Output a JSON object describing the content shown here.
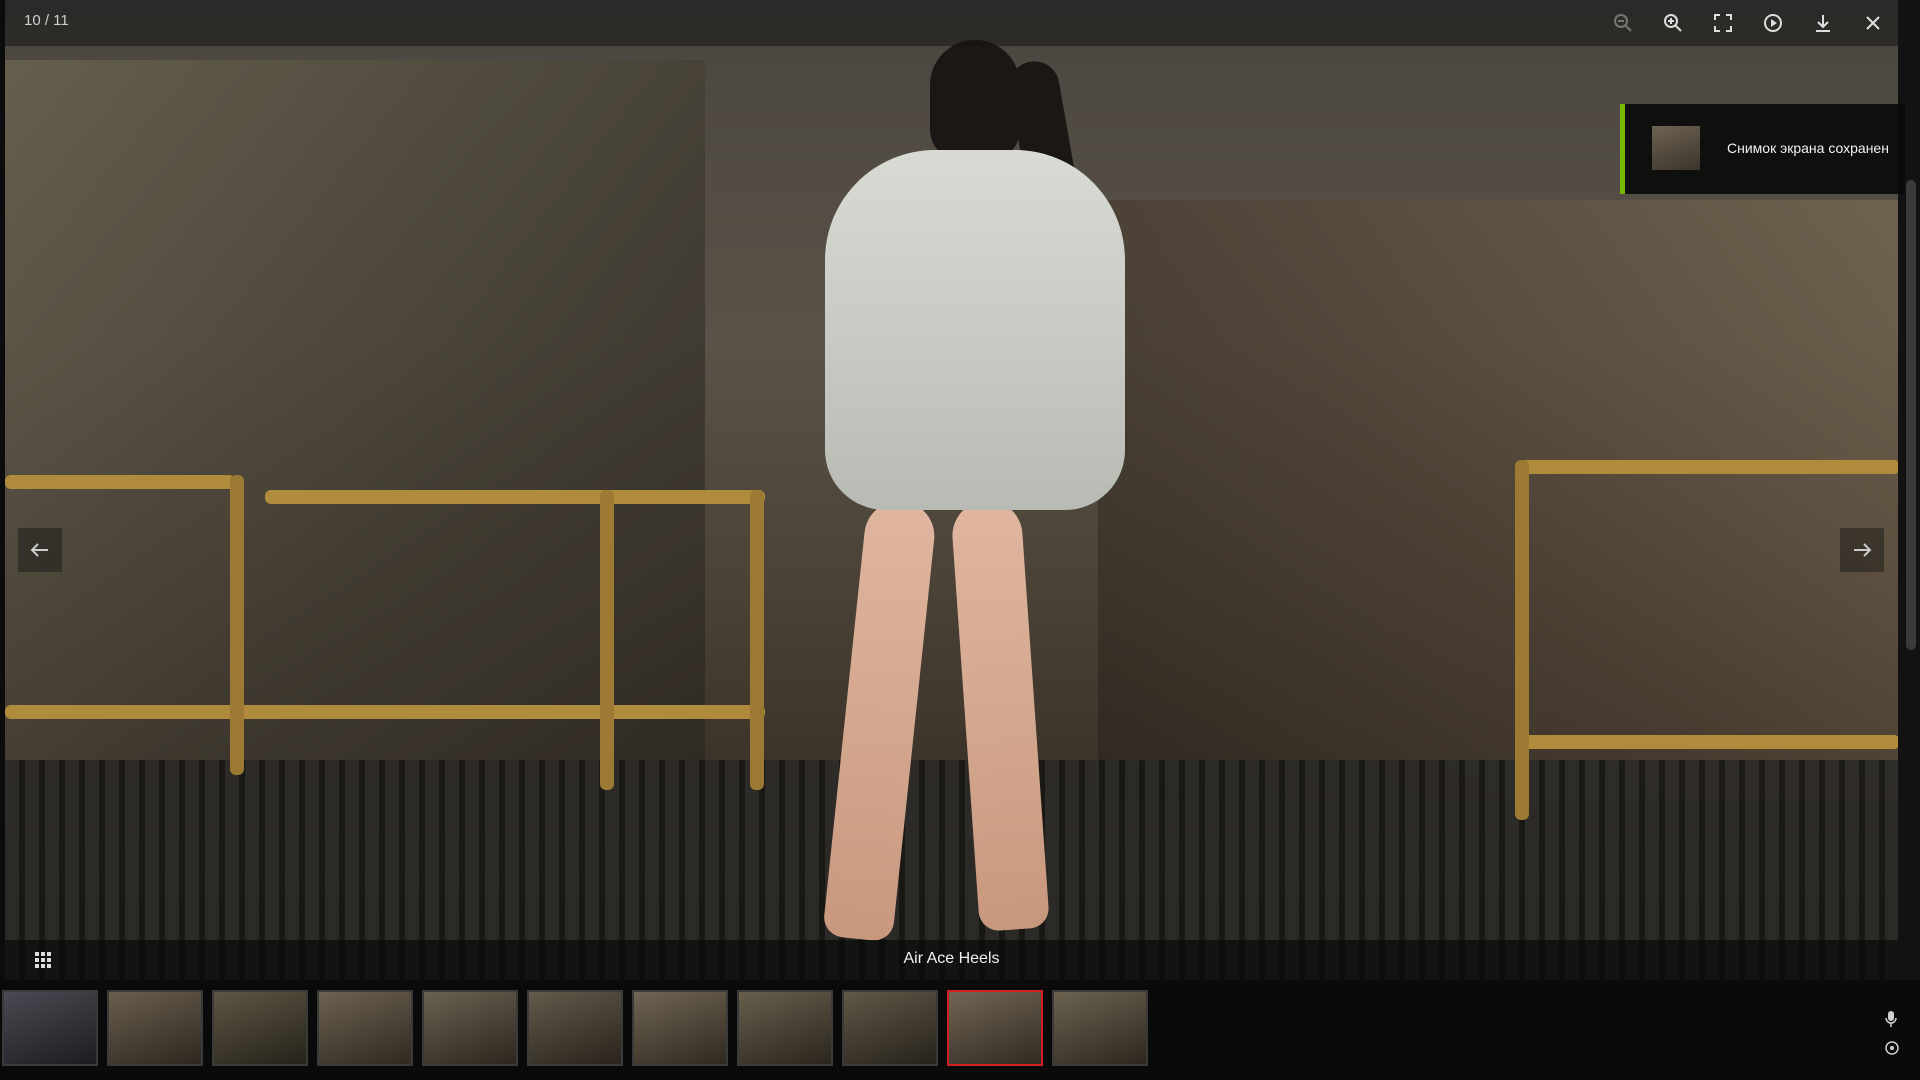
{
  "viewer": {
    "counter": "10 / 11",
    "caption": "Air Ace Heels",
    "toolbar": {
      "zoom_out": "zoom-out",
      "zoom_in": "zoom-in",
      "fullscreen": "fullscreen",
      "slideshow": "play",
      "download": "download",
      "close": "close"
    }
  },
  "toast": {
    "message": "Снимок экрана сохранен",
    "accent_color": "#76b900"
  },
  "thumbnails": {
    "count": 11,
    "selected_index": 9,
    "selected_color": "#d21e1e"
  }
}
